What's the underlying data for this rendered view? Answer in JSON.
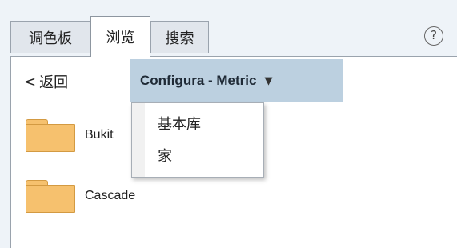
{
  "tabs": [
    {
      "label": "调色板",
      "active": false
    },
    {
      "label": "浏览",
      "active": true
    },
    {
      "label": "搜索",
      "active": false
    }
  ],
  "help": {
    "glyph": "?"
  },
  "navigation": {
    "back_glyph": "<",
    "back_label": "返回",
    "dropdown_label": "Configura - Metric",
    "dropdown_caret": "▼"
  },
  "items": [
    {
      "name": "Bukit",
      "icon": "folder-icon"
    },
    {
      "name": "Cascade",
      "icon": "folder-icon"
    }
  ],
  "dropdown_menu": [
    {
      "label": "基本库"
    },
    {
      "label": "家"
    }
  ],
  "colors": {
    "folder_fill": "#f6c16e",
    "dropdown_bg": "#bcd0e0",
    "page_bg": "#eef3f8"
  }
}
